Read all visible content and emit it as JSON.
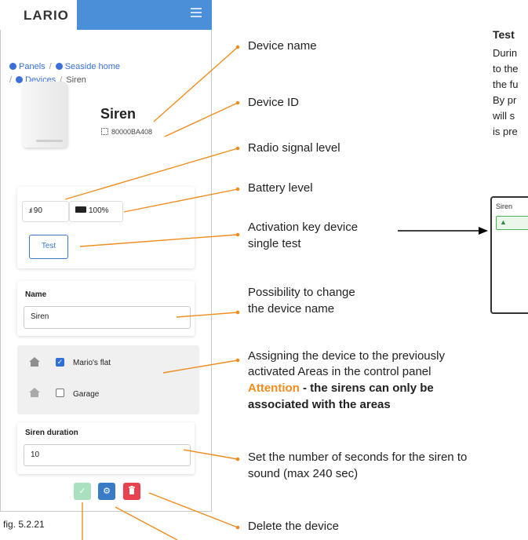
{
  "app": {
    "logo": "LARIO",
    "breadcrumb": {
      "panels": "Panels",
      "home": "Seaside home",
      "devices": "Devices",
      "current": "Siren",
      "separator": "/"
    }
  },
  "device": {
    "name": "Siren",
    "id": "80000BA408",
    "signal": "90",
    "battery": "100%",
    "test_label": "Test"
  },
  "form": {
    "name_label": "Name",
    "name_value": "Siren",
    "areas": [
      {
        "label": "Mario's flat",
        "checked": true
      },
      {
        "label": "Garage",
        "checked": false
      }
    ],
    "duration_label": "Siren duration",
    "duration_value": "10"
  },
  "actions": {
    "confirm_icon": "check-icon",
    "settings_icon": "gear-icon",
    "delete_icon": "trash-icon",
    "colors": {
      "confirm": "#a8e0c0",
      "settings": "#3a7bc8",
      "delete": "#e8414f"
    }
  },
  "figure_caption": "fig. 5.2.21",
  "annotations": {
    "device_name": "Device name",
    "device_id": "Device ID",
    "radio_signal": "Radio signal level",
    "battery": "Battery level",
    "test_line1": "Activation key device",
    "test_line2": "single test",
    "change_name_line1": "Possibility to change",
    "change_name_line2": "the device name",
    "areas_line1": "Assigning the device to the previously",
    "areas_line2": "activated Areas in the control panel",
    "attention_word": "Attention",
    "attention_rest": " - the sirens can only be",
    "attention_line2": "associated with the areas",
    "duration_line1": "Set the number of seconds for the siren to",
    "duration_line2": "sound (max 240 sec)",
    "delete": "Delete the device"
  },
  "side_panel": {
    "title": "Test",
    "text": "Durin\nto the\nthe fu\nBy pr\nwill s\nis pre",
    "mini_label": "Siren"
  },
  "colors": {
    "accent_blue": "#4a90d9",
    "annotation_line": "#f08c1e",
    "attention": "#f08c1e"
  }
}
